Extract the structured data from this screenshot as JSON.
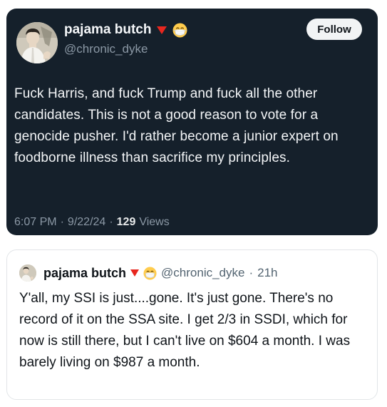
{
  "main_tweet": {
    "author_name": "pajama butch",
    "handle": "@chronic_dyke",
    "follow_label": "Follow",
    "text": "Fuck Harris, and fuck Trump and fuck all the other candidates. This is not a good reason to vote for a genocide pusher. I'd rather become a junior expert on foodborne illness than sacrifice my principles.",
    "time": "6:07 PM",
    "date": "9/22/24",
    "separator": "·",
    "views_count": "129",
    "views_label": "Views",
    "badge_icon": "red-triangle-icon",
    "emoji_icon": "face-with-medical-mask-icon"
  },
  "quoted_tweet": {
    "author_name": "pajama butch",
    "handle": "@chronic_dyke",
    "separator": "·",
    "time_ago": "21h",
    "text": "Y'all, my SSI is just....gone. It's just gone. There's no record of it on the SSA site. I get 2/3 in SSDI, which for now is still there, but I can't live on $604 a month. I was barely living on $987 a month.",
    "badge_icon": "red-triangle-icon",
    "emoji_icon": "face-with-medical-mask-icon"
  },
  "colors": {
    "dark_card_bg": "#15202b",
    "badge_red": "#e8271f",
    "muted_text": "#8b98a5",
    "follow_bg": "#f2f4f5"
  }
}
